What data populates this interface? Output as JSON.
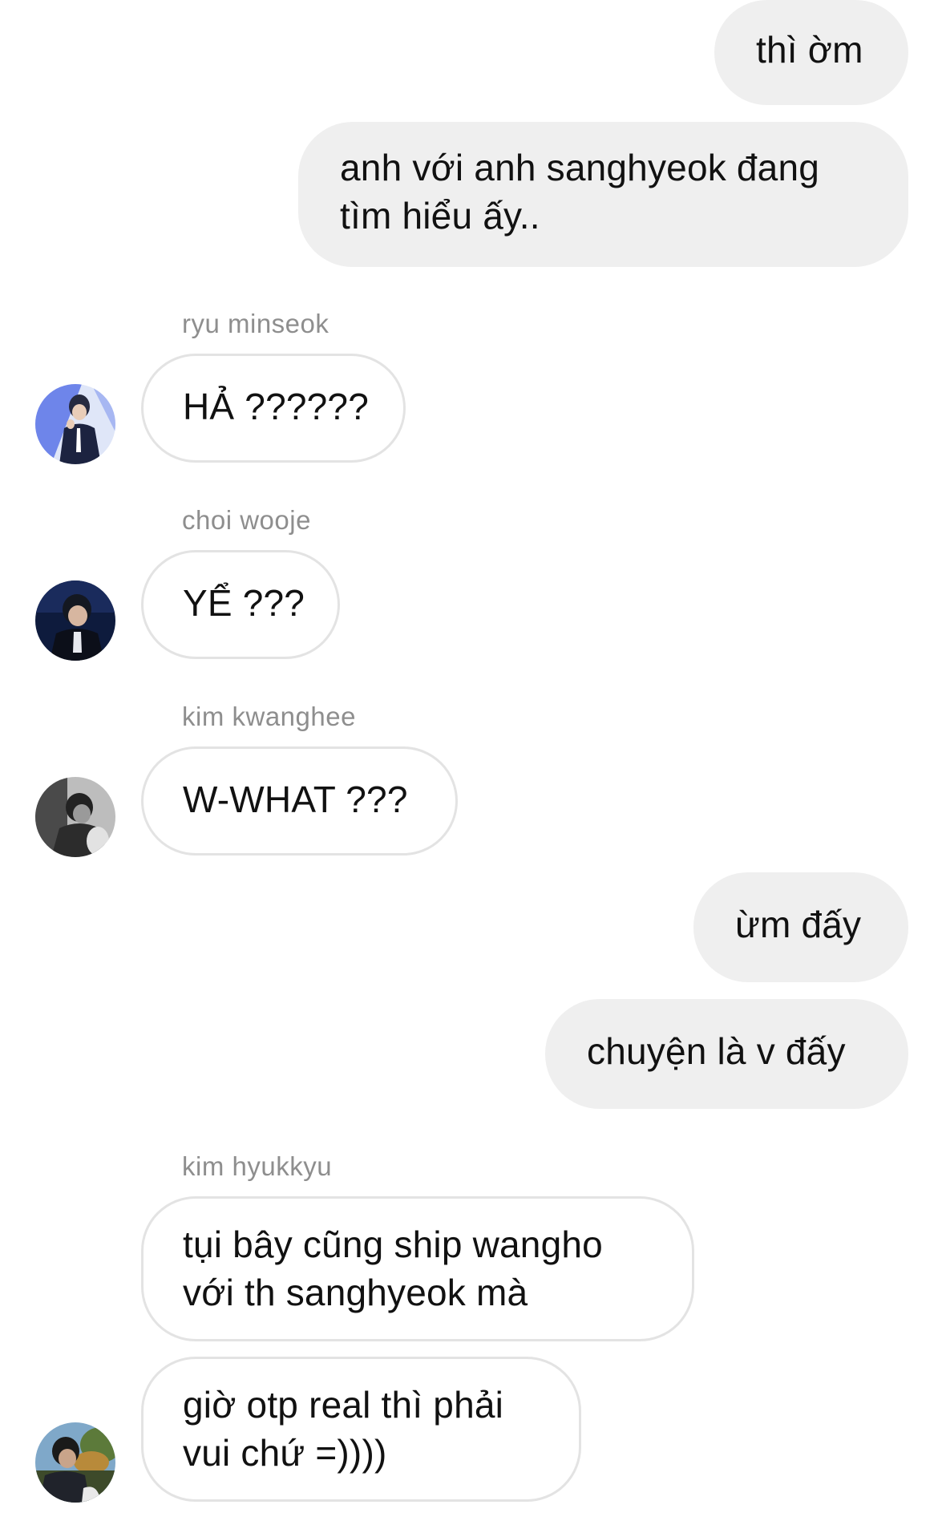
{
  "messages": [
    {
      "type": "outgoing",
      "lines": [
        "thì ờm"
      ]
    },
    {
      "type": "outgoing",
      "lines": [
        "anh với anh sanghyeok đang",
        "tìm hiểu ấy.."
      ]
    },
    {
      "type": "incoming",
      "sender": "ryu minseok",
      "lines": [
        "HẢ ??????"
      ],
      "avatar": "avatar-photo-ryu-minseok"
    },
    {
      "type": "incoming",
      "sender": "choi wooje",
      "lines": [
        "YỂ ???"
      ],
      "avatar": "avatar-photo-choi-wooje"
    },
    {
      "type": "incoming",
      "sender": "kim kwanghee",
      "lines": [
        "W-WHAT ???"
      ],
      "avatar": "avatar-photo-kim-kwanghee"
    },
    {
      "type": "outgoing",
      "lines": [
        "ừm đấy"
      ]
    },
    {
      "type": "outgoing",
      "lines": [
        "chuyện là v đấy"
      ]
    },
    {
      "type": "incoming",
      "sender": "kim hyukkyu",
      "lines": [
        "tụi bây cũng ship wangho",
        "với th sanghyeok mà"
      ]
    },
    {
      "type": "incoming",
      "lines": [
        "giờ otp real thì phải",
        "vui chứ =))))"
      ],
      "avatar": "avatar-photo-kim-hyukkyu"
    }
  ],
  "colors": {
    "outgoing_bubble": "#efefef",
    "incoming_border": "#e3e3e3",
    "sender_text": "#8e8e8e",
    "message_text": "#111111"
  }
}
